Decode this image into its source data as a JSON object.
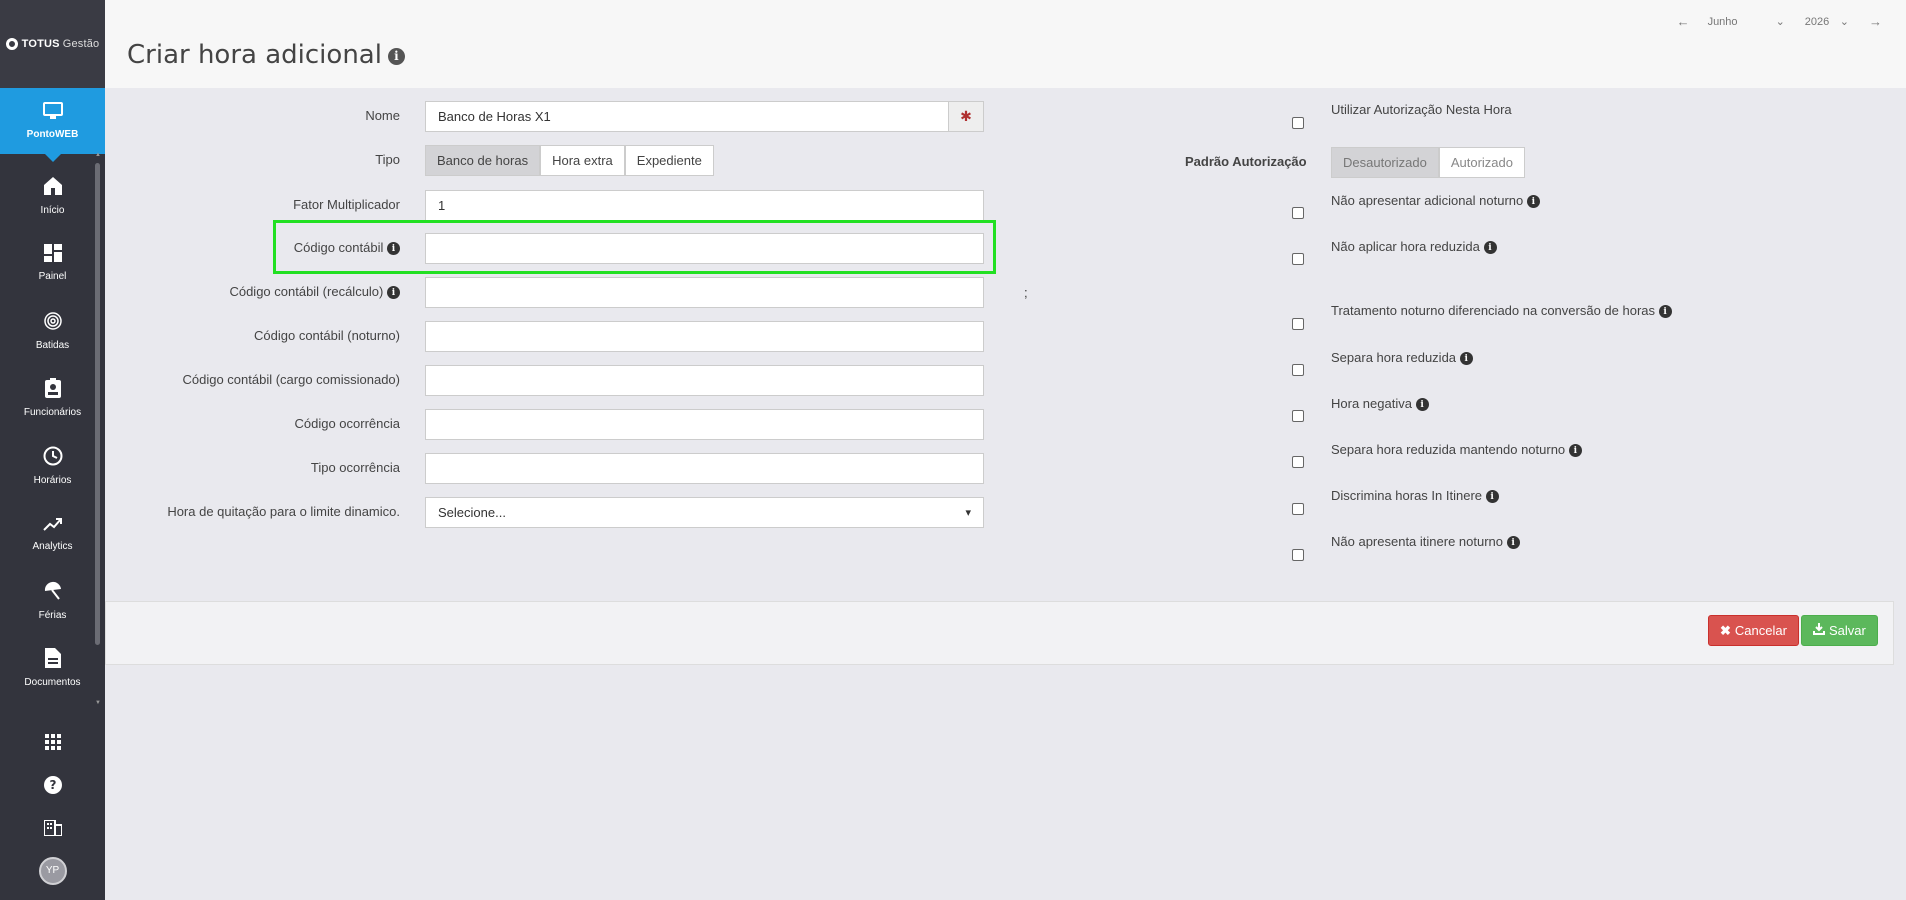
{
  "brand": {
    "logo_totus": "TOTUS",
    "logo_gestao": "Gestão"
  },
  "sidebar": {
    "active": {
      "label": "PontoWEB",
      "icon": "monitor-icon"
    },
    "items": [
      {
        "label": "Início",
        "icon": "home-icon"
      },
      {
        "label": "Painel",
        "icon": "dashboard-icon"
      },
      {
        "label": "Batidas",
        "icon": "fingerprint-icon"
      },
      {
        "label": "Funcionários",
        "icon": "id-badge-icon"
      },
      {
        "label": "Horários",
        "icon": "clock-icon"
      },
      {
        "label": "Analytics",
        "icon": "trend-icon"
      },
      {
        "label": "Férias",
        "icon": "umbrella-icon"
      },
      {
        "label": "Documentos",
        "icon": "document-icon"
      }
    ],
    "avatar": "YP"
  },
  "header": {
    "title": "Criar hora adicional",
    "month": "Junho",
    "year": "2026"
  },
  "form": {
    "nome_label": "Nome",
    "nome_value": "Banco de Horas X1",
    "tipo_label": "Tipo",
    "tipo_options": [
      "Banco de horas",
      "Hora extra",
      "Expediente"
    ],
    "fator_label": "Fator Multiplicador",
    "fator_value": "1",
    "codigo_contabil_label": "Código contábil",
    "codigo_recalculo_label": "Código contábil (recálculo)",
    "codigo_noturno_label": "Código contábil (noturno)",
    "codigo_cargo_label": "Código contábil (cargo comissionado)",
    "codigo_ocorrencia_label": "Código ocorrência",
    "tipo_ocorrencia_label": "Tipo ocorrência",
    "hora_quitacao_label": "Hora de quitação para o limite dinamico.",
    "hora_quitacao_value": "Selecione...",
    "semicolon": ";"
  },
  "options": {
    "utilizar_autorizacao": "Utilizar Autorização Nesta Hora",
    "padrao_autorizacao_label": "Padrão Autorização",
    "padrao_desautorizado": "Desautorizado",
    "padrao_autorizado": "Autorizado",
    "nao_apresentar_adicional": "Não apresentar adicional noturno",
    "nao_aplicar_reduzida": "Não aplicar hora reduzida",
    "tratamento_noturno": "Tratamento noturno diferenciado na conversão de horas",
    "separa_reduzida": "Separa hora reduzida",
    "hora_negativa": "Hora negativa",
    "separa_reduzida_noturno": "Separa hora reduzida mantendo noturno",
    "discrimina_itinere": "Discrimina horas In Itinere",
    "nao_apresenta_itinere": "Não apresenta itinere noturno"
  },
  "actions": {
    "cancel": "Cancelar",
    "save": "Salvar"
  },
  "colors": {
    "accent": "#1f9be0",
    "cancel": "#d9534f",
    "save": "#5cb85c",
    "highlight": "#22e022"
  }
}
